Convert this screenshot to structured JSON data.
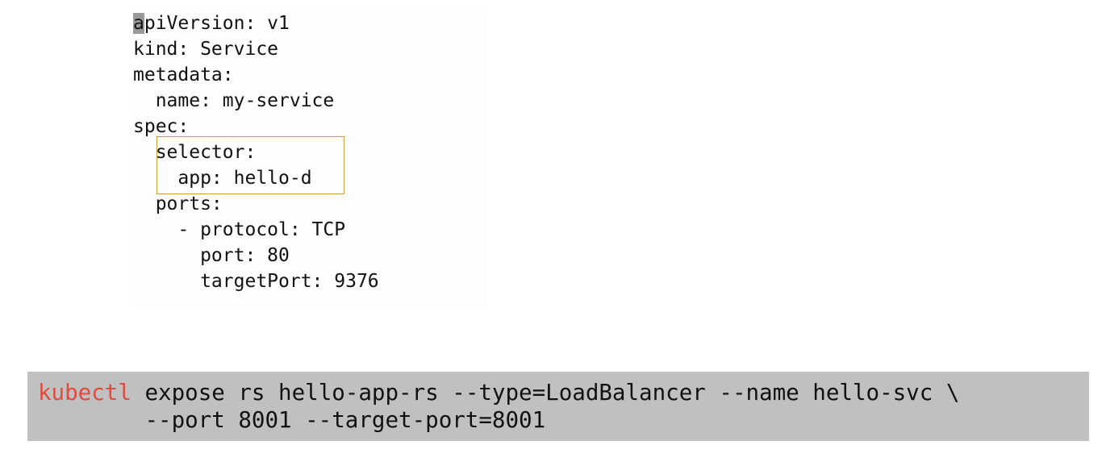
{
  "yaml": {
    "cursor_char": "a",
    "line1_rest": "piVersion: v1",
    "lines": [
      "kind: Service",
      "metadata:",
      "  name: my-service",
      "spec:",
      "  selector:",
      "    app: hello-d",
      "  ports:",
      "    - protocol: TCP",
      "      port: 80",
      "      targetPort: 9376"
    ]
  },
  "command": {
    "keyword": "kubectl",
    "line1_rest": " expose rs hello-app-rs --type=LoadBalancer --name hello-svc \\",
    "line2": "        --port 8001 --target-port=8001"
  },
  "colors": {
    "keyword": "#e04a3f",
    "command_background": "#c0c0c0",
    "highlight_border": "#c8a13a",
    "cursor": "#9a9a9a"
  }
}
